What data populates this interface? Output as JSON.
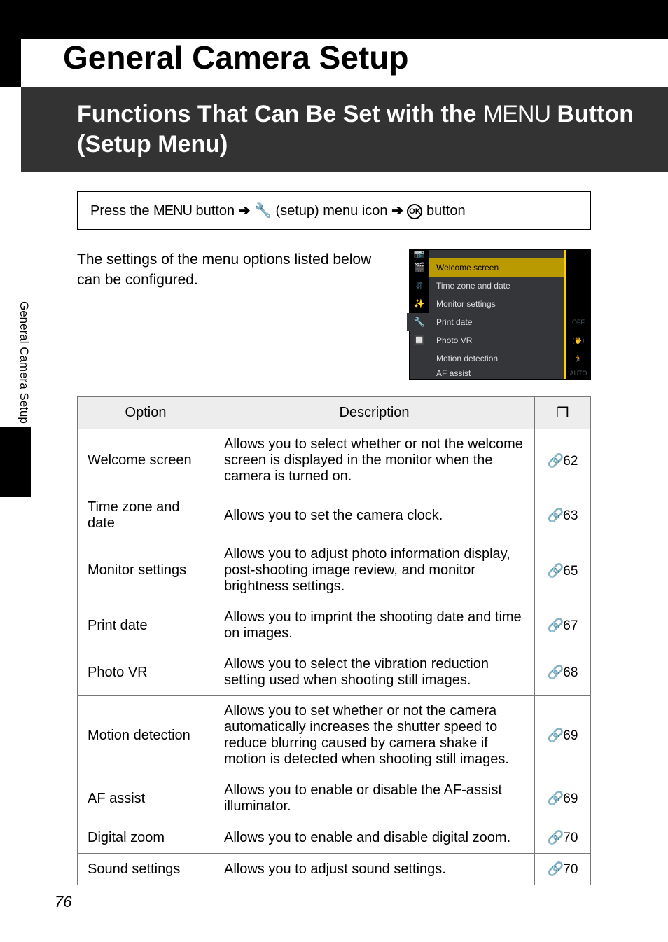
{
  "page_number": "76",
  "side_label": "General Camera Setup",
  "title": "General Camera Setup",
  "section_heading_pre": "Functions That Can Be Set with the ",
  "section_heading_menu": "MENU",
  "section_heading_post": " Button (Setup Menu)",
  "instruction": {
    "pre": "Press the ",
    "menu": "MENU",
    "mid1": " button ",
    "arrow1": "➔",
    "wrench": "🔧",
    "mid2": " (setup) menu icon ",
    "arrow2": "➔",
    "ok": "OK",
    "post": " button"
  },
  "intro_text": "The settings of the menu options listed below can be configured.",
  "camera_screen": {
    "tabs": [
      "📷",
      "🎬",
      "⇵",
      "✨",
      "🔧",
      "🔲"
    ],
    "items": [
      {
        "label": "Welcome screen",
        "hilite": true,
        "right": ""
      },
      {
        "label": "Time zone and date",
        "right": ""
      },
      {
        "label": "Monitor settings",
        "right": ""
      },
      {
        "label": "Print date",
        "right": "OFF"
      },
      {
        "label": "Photo VR",
        "right": "(🖐)"
      },
      {
        "label": "Motion detection",
        "right": "🏃"
      },
      {
        "label": "AF assist",
        "right": "AUTO"
      }
    ]
  },
  "table": {
    "headers": {
      "option": "Option",
      "description": "Description",
      "ref_icon": "❐"
    },
    "ref_prefix": "🔗",
    "rows": [
      {
        "option": "Welcome screen",
        "description": "Allows you to select whether or not the welcome screen is displayed in the monitor when the camera is turned on.",
        "ref": "62"
      },
      {
        "option": "Time zone and date",
        "description": "Allows you to set the camera clock.",
        "ref": "63"
      },
      {
        "option": "Monitor settings",
        "description": "Allows you to adjust photo information display, post-shooting image review, and monitor brightness settings.",
        "ref": "65"
      },
      {
        "option": "Print date",
        "description": "Allows you to imprint the shooting date and time on images.",
        "ref": "67"
      },
      {
        "option": "Photo VR",
        "description": "Allows you to select the vibration reduction setting used when shooting still images.",
        "ref": "68"
      },
      {
        "option": "Motion detection",
        "description": "Allows you to set whether or not the camera automatically increases the shutter speed to reduce blurring caused by camera shake if motion is detected when shooting still images.",
        "ref": "69"
      },
      {
        "option": "AF assist",
        "description": "Allows you to enable or disable the AF-assist illuminator.",
        "ref": "69"
      },
      {
        "option": "Digital zoom",
        "description": "Allows you to enable and disable digital zoom.",
        "ref": "70"
      },
      {
        "option": "Sound settings",
        "description": "Allows you to adjust sound settings.",
        "ref": "70"
      }
    ]
  }
}
